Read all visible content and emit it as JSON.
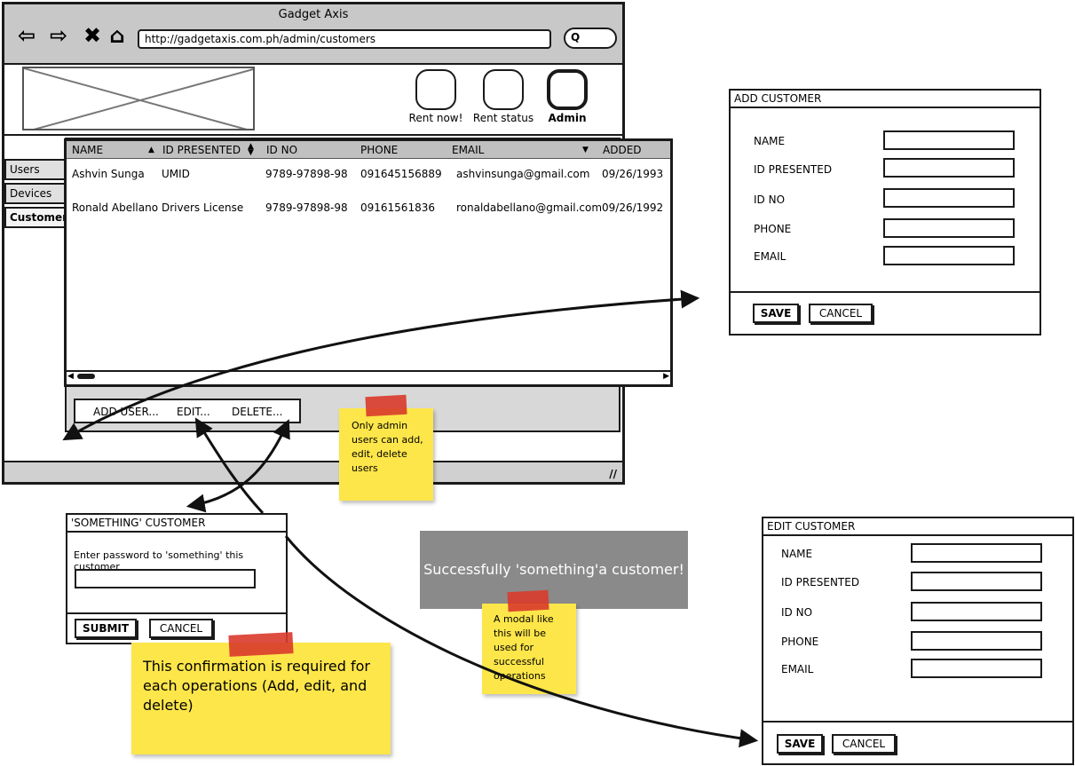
{
  "browser": {
    "title": "Gadget Axis",
    "url": "http://gadgetaxis.com.ph/admin/customers",
    "search_icon": "Q"
  },
  "header_buttons": [
    {
      "label": "Rent now!"
    },
    {
      "label": "Rent status"
    },
    {
      "label": "Admin"
    }
  ],
  "sidebar": {
    "items": [
      {
        "label": "Users"
      },
      {
        "label": "Devices"
      },
      {
        "label": "Customers"
      }
    ]
  },
  "table": {
    "columns": [
      "NAME",
      "ID PRESENTED",
      "ID NO",
      "PHONE",
      "EMAIL",
      "ADDED"
    ],
    "rows": [
      [
        "Ashvin Sunga",
        "UMID",
        "9789-97898-98",
        "091645156889",
        "ashvinsunga@gmail.com",
        "09/26/1993"
      ],
      [
        "Ronald Abellano",
        "Drivers License",
        "9789-97898-98",
        "09161561836",
        "ronaldabellano@gmail.com",
        "09/26/1992"
      ]
    ]
  },
  "actions": {
    "add": "ADD USER...",
    "edit": "EDIT...",
    "delete": "DELETE..."
  },
  "note_admin": "Only admin users can add, edit, delete users",
  "add_dialog": {
    "title": "ADD CUSTOMER",
    "fields": [
      "NAME",
      "ID PRESENTED",
      "ID NO",
      "PHONE",
      "EMAIL"
    ],
    "save": "SAVE",
    "cancel": "CANCEL"
  },
  "edit_dialog": {
    "title": "EDIT CUSTOMER",
    "fields": [
      "NAME",
      "ID PRESENTED",
      "ID NO",
      "PHONE",
      "EMAIL"
    ],
    "save": "SAVE",
    "cancel": "CANCEL"
  },
  "confirm_dialog": {
    "title": "'SOMETHING' CUSTOMER",
    "prompt": "Enter password to 'something' this customer",
    "submit": "SUBMIT",
    "cancel": "CANCEL"
  },
  "note_confirm": "This confirmation is required for each operations (Add, edit, and delete)",
  "toast": {
    "message": "Successfully 'something'a customer!"
  },
  "note_toast": "A modal like this will be used for successful operations",
  "colors": {
    "sticky": "#fde64a",
    "tape": "#d93a2b",
    "toast_bg": "#8a8a8a",
    "chrome": "#c8c8c8"
  }
}
